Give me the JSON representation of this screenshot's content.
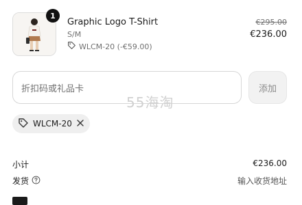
{
  "item": {
    "quantity": "1",
    "title": "Graphic Logo T-Shirt",
    "variant": "S/M",
    "discount_label": "WLCM-20 (-€59.00)",
    "original_price": "€295.00",
    "price": "€236.00"
  },
  "discount_form": {
    "placeholder": "折扣码或礼品卡",
    "apply_label": "添加"
  },
  "watermark": "55海淘",
  "applied_code": {
    "code": "WLCM-20"
  },
  "summary": {
    "subtotal_label": "小计",
    "subtotal_value": "€236.00",
    "shipping_label": "发货",
    "shipping_value": "输入收货地址"
  },
  "colors": {
    "text": "#1a1a1a",
    "muted": "#707070",
    "border": "#d6d6d6",
    "chip_bg": "#efefef"
  }
}
